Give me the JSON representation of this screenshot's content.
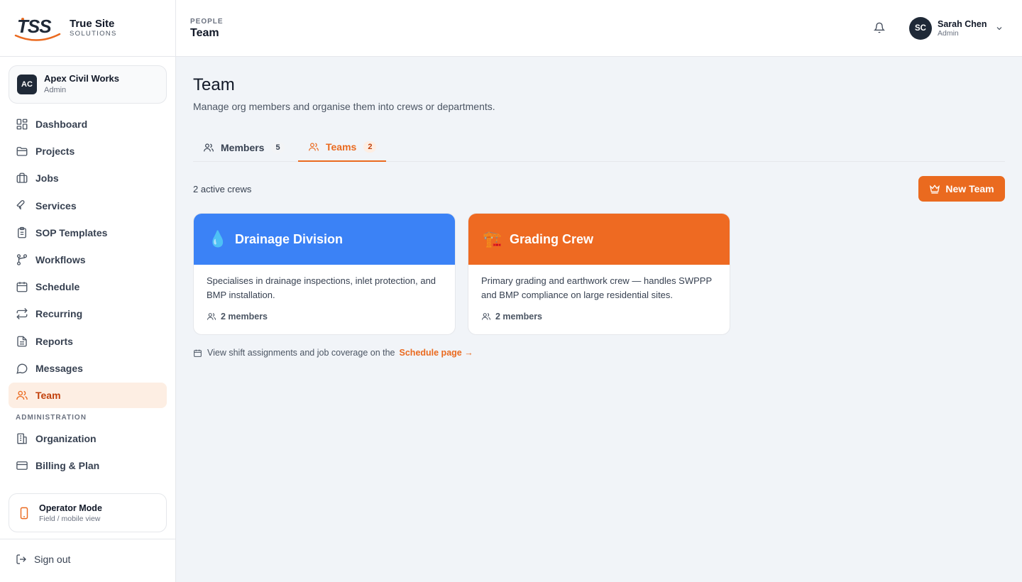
{
  "brand": {
    "logo_text": "TSS",
    "name": "True Site",
    "sub": "SOLUTIONS"
  },
  "org": {
    "initials": "AC",
    "name": "Apex Civil Works",
    "role": "Admin"
  },
  "nav": {
    "items": [
      {
        "label": "Dashboard",
        "icon": "dashboard-icon"
      },
      {
        "label": "Projects",
        "icon": "folder-icon"
      },
      {
        "label": "Jobs",
        "icon": "briefcase-icon"
      },
      {
        "label": "Services",
        "icon": "wrench-icon"
      },
      {
        "label": "SOP Templates",
        "icon": "clipboard-icon"
      },
      {
        "label": "Workflows",
        "icon": "workflow-icon"
      },
      {
        "label": "Schedule",
        "icon": "calendar-icon"
      },
      {
        "label": "Recurring",
        "icon": "repeat-icon"
      },
      {
        "label": "Reports",
        "icon": "document-icon"
      },
      {
        "label": "Messages",
        "icon": "message-icon"
      },
      {
        "label": "Team",
        "icon": "users-icon",
        "active": true
      }
    ],
    "admin_section": "ADMINISTRATION",
    "admin_items": [
      {
        "label": "Organization",
        "icon": "building-icon"
      },
      {
        "label": "Billing & Plan",
        "icon": "credit-card-icon"
      }
    ]
  },
  "operator": {
    "title": "Operator Mode",
    "sub": "Field / mobile view"
  },
  "signout": {
    "label": "Sign out"
  },
  "topbar": {
    "section": "PEOPLE",
    "title": "Team"
  },
  "user": {
    "initials": "SC",
    "name": "Sarah Chen",
    "role": "Admin"
  },
  "page": {
    "title": "Team",
    "description": "Manage org members and organise them into crews or departments."
  },
  "tabs": [
    {
      "label": "Members",
      "count": "5",
      "active": false
    },
    {
      "label": "Teams",
      "count": "2",
      "active": true
    }
  ],
  "toolbar": {
    "crew_count": "2 active crews",
    "new_team_label": "New Team"
  },
  "teams": [
    {
      "emoji": "💧",
      "name": "Drainage Division",
      "color": "#3b82f6",
      "description": "Specialises in drainage inspections, inlet protection, and BMP installation.",
      "members": "2 members"
    },
    {
      "emoji": "🏗️",
      "name": "Grading Crew",
      "color": "#ee6a22",
      "description": "Primary grading and earthwork crew — handles SWPPP and BMP compliance on large residential sites.",
      "members": "2 members"
    }
  ],
  "schedule_note": {
    "text": "View shift assignments and job coverage on the",
    "link": "Schedule page →"
  },
  "colors": {
    "accent": "#ea6a1f",
    "active_bg": "#fdeee3",
    "dark": "#1f2937"
  }
}
